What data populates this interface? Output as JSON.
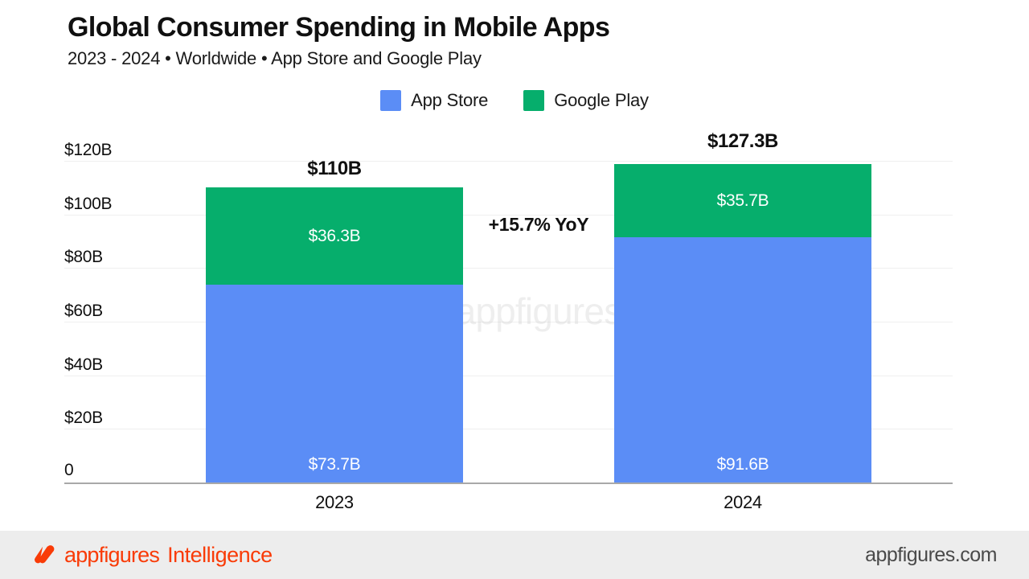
{
  "header": {
    "title": "Global Consumer Spending in Mobile Apps",
    "subtitle": "2023 - 2024 • Worldwide • App Store and Google Play"
  },
  "legend": {
    "items": [
      {
        "label": "App Store",
        "color": "#5b8df6",
        "swatch_icon": "square-swatch-icon"
      },
      {
        "label": "Google Play",
        "color": "#06ae6c",
        "swatch_icon": "square-swatch-icon"
      }
    ]
  },
  "annotation": {
    "yoy": "+15.7% YoY"
  },
  "watermark": {
    "text": "appfigures",
    "logo_icon": "appfigures-logo-icon"
  },
  "footer": {
    "brand": "appfigures",
    "brand_suffix": "Intelligence",
    "logo_icon": "appfigures-logo-icon",
    "url": "appfigures.com"
  },
  "colors": {
    "app_store": "#5b8df6",
    "google_play": "#06ae6c",
    "brand_orange": "#f93b07",
    "grid": "#efefef",
    "axis": "#a8a8a8",
    "footer_bg": "#ededed"
  },
  "chart_data": {
    "type": "bar",
    "subtype": "stacked-vertical",
    "title": "Global Consumer Spending in Mobile Apps",
    "subtitle": "2023 - 2024 • Worldwide • App Store and Google Play",
    "xlabel": "",
    "ylabel": "",
    "categories": [
      "2023",
      "2024"
    ],
    "series": [
      {
        "name": "App Store",
        "color": "#5b8df6",
        "values": [
          73.7,
          91.6
        ],
        "labels": [
          "$73.7B",
          "$91.6B"
        ]
      },
      {
        "name": "Google Play",
        "color": "#06ae6c",
        "values": [
          36.3,
          35.7
        ],
        "labels": [
          "$36.3B",
          "$35.7B"
        ]
      }
    ],
    "totals": [
      110.0,
      127.3
    ],
    "total_labels": [
      "$110B",
      "$127.3B"
    ],
    "ylim": [
      0,
      126
    ],
    "y_ticks": [
      0,
      20,
      40,
      60,
      80,
      100,
      120
    ],
    "y_tick_labels": [
      "0",
      "$20B",
      "$40B",
      "$60B",
      "$80B",
      "$100B",
      "$120B"
    ],
    "grid": true,
    "grid_axis": "y",
    "legend_position": "top-center",
    "annotations": [
      "+15.7% YoY"
    ],
    "units": "USD billions"
  }
}
